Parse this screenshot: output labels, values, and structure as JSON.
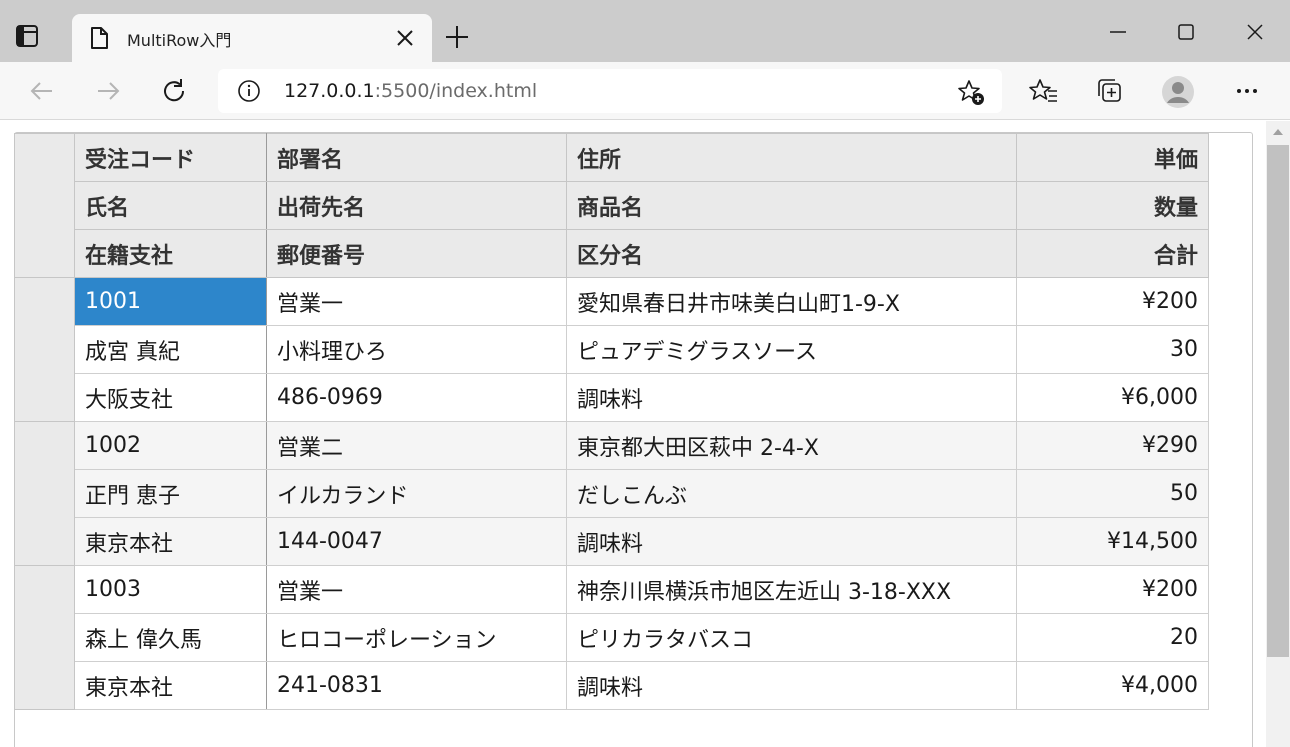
{
  "browser": {
    "tab_title": "MultiRow入門",
    "url_host": "127.0.0.1",
    "url_rest": ":5500/index.html"
  },
  "icons": {
    "tab_actions": "tab-actions-icon",
    "favicon": "page-icon",
    "close": "close-icon",
    "new_tab": "plus-icon",
    "back": "arrow-left-icon",
    "forward": "arrow-right-icon",
    "reload": "reload-icon",
    "info": "info-icon",
    "add_favorite": "star-plus-icon",
    "favorites": "favorites-icon",
    "collections": "collections-icon",
    "profile": "profile-icon",
    "more": "more-icon"
  },
  "colors": {
    "selection": "#2d86cb",
    "header_bg": "#eaeaea",
    "alt_row_bg": "#f5f5f5",
    "tabbar_bg": "#cccccc"
  },
  "grid": {
    "header": [
      [
        "受注コード",
        "部署名",
        "住所",
        "単価"
      ],
      [
        "氏名",
        "出荷先名",
        "商品名",
        "数量"
      ],
      [
        "在籍支社",
        "郵便番号",
        "区分名",
        "合計"
      ]
    ],
    "records": [
      [
        [
          "1001",
          "営業一",
          "愛知県春日井市味美白山町1-9-X",
          "¥200"
        ],
        [
          "成宮 真紀",
          "小料理ひろ",
          "ピュアデミグラスソース",
          "30"
        ],
        [
          "大阪支社",
          "486-0969",
          "調味料",
          "¥6,000"
        ]
      ],
      [
        [
          "1002",
          "営業二",
          "東京都大田区萩中 2-4-X",
          "¥290"
        ],
        [
          "正門 恵子",
          "イルカランド",
          "だしこんぶ",
          "50"
        ],
        [
          "東京本社",
          "144-0047",
          "調味料",
          "¥14,500"
        ]
      ],
      [
        [
          "1003",
          "営業一",
          "神奈川県横浜市旭区左近山 3-18-XXX",
          "¥200"
        ],
        [
          "森上 偉久馬",
          "ヒロコーポレーション",
          "ピリカラタバスコ",
          "20"
        ],
        [
          "東京本社",
          "241-0831",
          "調味料",
          "¥4,000"
        ]
      ]
    ]
  }
}
